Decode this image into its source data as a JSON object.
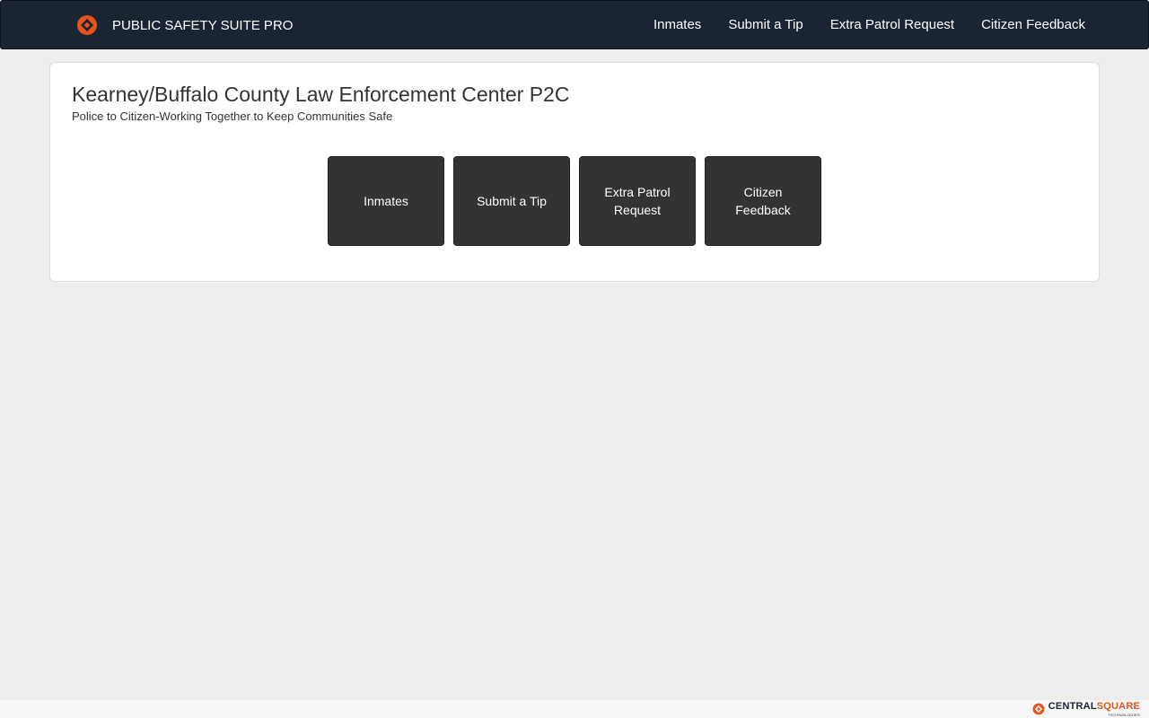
{
  "header": {
    "brand_name": "PUBLIC SAFETY SUITE PRO",
    "logo_icon": "centralsquare-diamond-icon",
    "nav": [
      {
        "label": "Inmates"
      },
      {
        "label": "Submit a Tip"
      },
      {
        "label": "Extra Patrol Request"
      },
      {
        "label": "Citizen Feedback"
      }
    ]
  },
  "main": {
    "title": "Kearney/Buffalo County Law Enforcement Center P2C",
    "subtitle": "Police to Citizen-Working Together to Keep Communities Safe",
    "tiles": [
      {
        "label": "Inmates"
      },
      {
        "label": "Submit a Tip"
      },
      {
        "label": "Extra Patrol Request"
      },
      {
        "label": "Citizen Feedback"
      }
    ]
  },
  "footer": {
    "logo_word_a": "CENTRAL",
    "logo_word_b": "SQUARE",
    "logo_sub": "TECHNOLOGIES"
  },
  "colors": {
    "navbar_bg": "#1b2433",
    "page_bg": "#ededed",
    "tile_bg": "#333333",
    "accent_orange": "#e8541d"
  }
}
